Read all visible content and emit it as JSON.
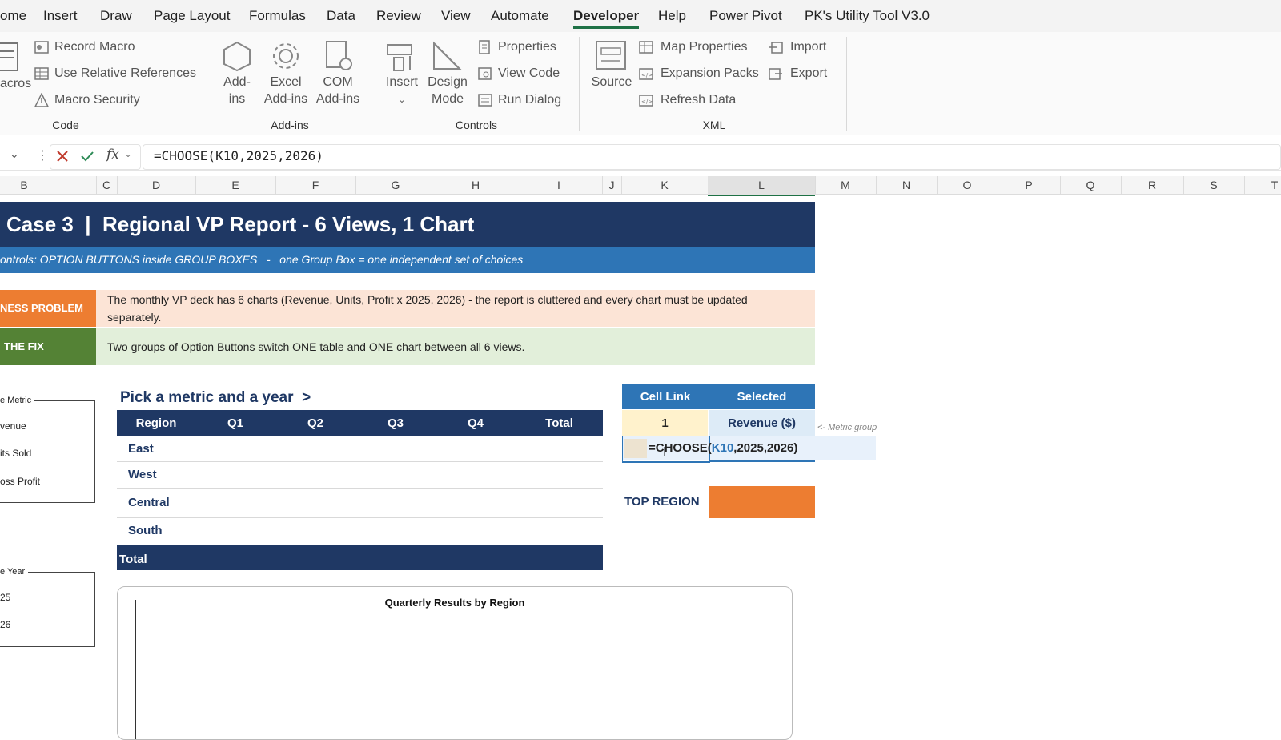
{
  "ribbon_tabs": [
    "ome",
    "Insert",
    "Draw",
    "Page Layout",
    "Formulas",
    "Data",
    "Review",
    "View",
    "Automate",
    "Developer",
    "Help",
    "Power Pivot",
    "PK's Utility Tool V3.0"
  ],
  "active_tab": "Developer",
  "ribbon": {
    "code": {
      "macros_label": "acros",
      "record_macro": "Record Macro",
      "use_relative": "Use Relative References",
      "macro_security": "Macro Security",
      "group": "Code"
    },
    "addins": {
      "addins_1": "Add-",
      "addins_2": "ins",
      "excel_addins_1": "Excel",
      "excel_addins_2": "Add-ins",
      "com_addins_1": "COM",
      "com_addins_2": "Add-ins",
      "group": "Add-ins"
    },
    "controls": {
      "insert": "Insert",
      "design_mode_1": "Design",
      "design_mode_2": "Mode",
      "properties": "Properties",
      "view_code": "View Code",
      "run_dialog": "Run Dialog",
      "group": "Controls"
    },
    "xml": {
      "source": "Source",
      "map_properties": "Map Properties",
      "expansion_packs": "Expansion Packs",
      "refresh_data": "Refresh Data",
      "import": "Import",
      "export": "Export",
      "group": "XML"
    }
  },
  "formula_bar": {
    "fx": "fx",
    "formula": "=CHOOSE(K10,2025,2026)"
  },
  "columns": [
    "B",
    "C",
    "D",
    "E",
    "F",
    "G",
    "H",
    "I",
    "J",
    "K",
    "L",
    "M",
    "N",
    "O",
    "P",
    "Q",
    "R",
    "S",
    "T"
  ],
  "selected_column": "L",
  "sheet": {
    "title": "Case 3  |  Regional VP Report - 6 Views, 1 Chart",
    "subtitle_left": "ontrols: OPTION BUTTONS inside GROUP BOXES   -   one Group Box = one independent set of choices",
    "problem_label": "NESS PROBLEM",
    "problem_text_1": "The monthly VP deck has 6 charts (Revenue, Units, Profit x 2025, 2026) - the report is cluttered and every chart must be updated",
    "problem_text_2": "separately.",
    "fix_label": "THE FIX",
    "fix_text": "Two groups of Option Buttons switch ONE table and ONE chart between all 6 views.",
    "metric_group": {
      "title": "e Metric",
      "options": [
        "venue",
        "its Sold",
        "oss Profit"
      ]
    },
    "year_group": {
      "title": "e Year",
      "options": [
        "25",
        "26"
      ]
    },
    "prompt": "Pick a metric and a year  >",
    "table": {
      "headers": [
        "Region",
        "Q1",
        "Q2",
        "Q3",
        "Q4",
        "Total"
      ],
      "rows": [
        "East",
        "West",
        "Central",
        "South"
      ],
      "total_label": "Total"
    },
    "link_table": {
      "headers": [
        "Cell Link",
        "Selected"
      ],
      "value": "1",
      "selected": "Revenue ($)",
      "note": "<- Metric group",
      "edit_prefix": "=CHOOSE(",
      "edit_ref": "K10",
      "edit_suffix": ",2025,2026)"
    },
    "top_region_label": "TOP REGION",
    "chart_title": "Quarterly Results by Region"
  },
  "colors": {
    "navy": "#1f3864",
    "blue": "#2e75b6",
    "orange": "#ed7d31",
    "green": "#548235",
    "problem_bg": "#fce4d6",
    "fix_bg": "#e2efda",
    "link_value_bg": "#fff2cc",
    "link_sel_bg": "#ddebf7"
  }
}
